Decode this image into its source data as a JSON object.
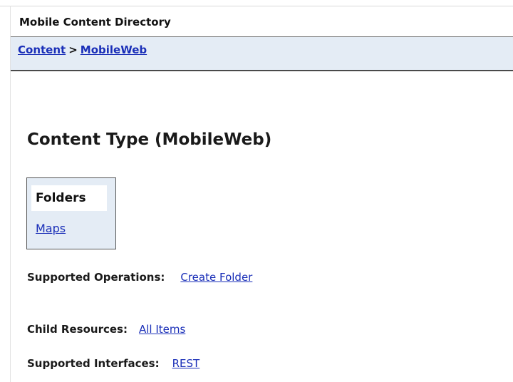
{
  "header": {
    "title": "Mobile Content Directory"
  },
  "breadcrumb": {
    "items": [
      {
        "label": "Content"
      },
      {
        "label": "MobileWeb"
      }
    ],
    "separator": ">"
  },
  "main": {
    "page_title": "Content Type (MobileWeb)",
    "folders": {
      "header": "Folders",
      "items": [
        {
          "label": "Maps"
        }
      ]
    },
    "supported_operations": {
      "label": "Supported Operations:",
      "links": [
        {
          "label": "Create Folder"
        }
      ]
    },
    "child_resources": {
      "label": "Child Resources:",
      "links": [
        {
          "label": "All Items"
        }
      ]
    },
    "supported_interfaces": {
      "label": "Supported Interfaces:",
      "links": [
        {
          "label": "REST"
        }
      ]
    }
  },
  "colors": {
    "link": "#1a2fb8",
    "panel_background": "#e4ecf5",
    "text": "#1a1a1a"
  }
}
